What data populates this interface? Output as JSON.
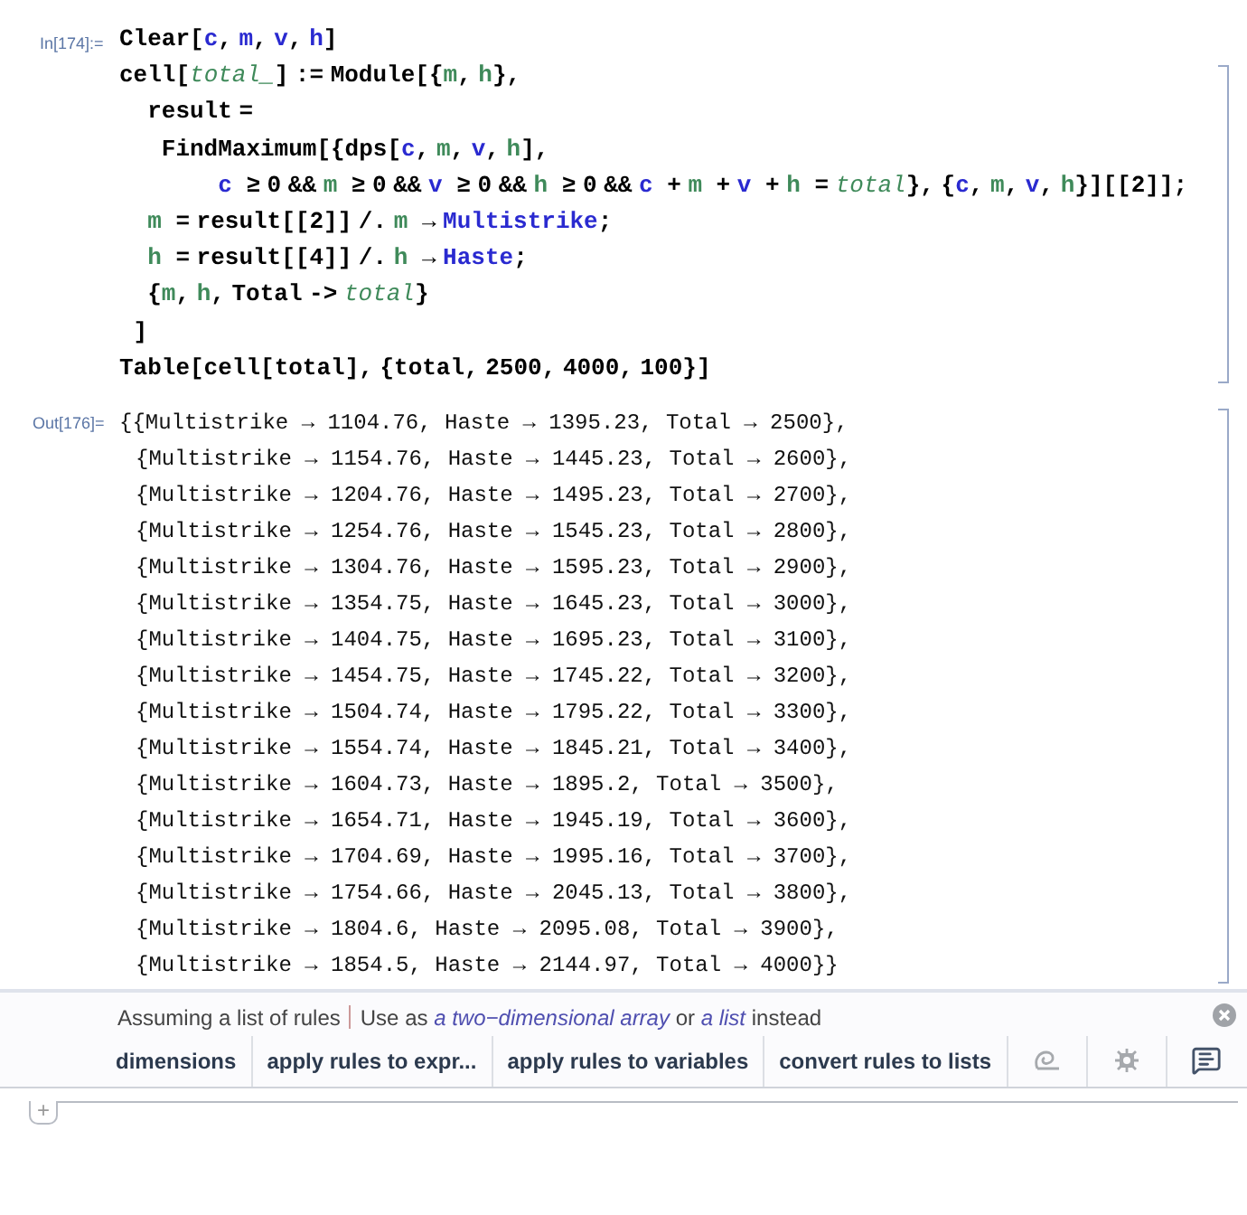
{
  "input_cell": {
    "label": "In[174]:=",
    "lines": [
      [
        {
          "text": "Clear[",
          "kind": "plain"
        },
        {
          "text": "c",
          "kind": "global"
        },
        {
          "text": ", ",
          "kind": "plain"
        },
        {
          "text": "m",
          "kind": "global"
        },
        {
          "text": ", ",
          "kind": "plain"
        },
        {
          "text": "v",
          "kind": "global"
        },
        {
          "text": ", ",
          "kind": "plain"
        },
        {
          "text": "h",
          "kind": "global"
        },
        {
          "text": "]",
          "kind": "plain"
        }
      ],
      [
        {
          "text": "cell[",
          "kind": "plain"
        },
        {
          "text": "total_",
          "kind": "pattern"
        },
        {
          "text": "] := Module[{",
          "kind": "plain"
        },
        {
          "text": "m",
          "kind": "local"
        },
        {
          "text": ", ",
          "kind": "plain"
        },
        {
          "text": "h",
          "kind": "local"
        },
        {
          "text": "},",
          "kind": "plain"
        }
      ],
      [
        {
          "text": "  result =",
          "kind": "plain"
        }
      ],
      [
        {
          "text": "   FindMaximum[{dps[",
          "kind": "plain"
        },
        {
          "text": "c",
          "kind": "global"
        },
        {
          "text": ", ",
          "kind": "plain"
        },
        {
          "text": "m",
          "kind": "local"
        },
        {
          "text": ", ",
          "kind": "plain"
        },
        {
          "text": "v",
          "kind": "global"
        },
        {
          "text": ", ",
          "kind": "plain"
        },
        {
          "text": "h",
          "kind": "local"
        },
        {
          "text": "],",
          "kind": "plain"
        }
      ],
      [
        {
          "text": "       c",
          "kind": "global"
        },
        {
          "text": " ≥ 0 && ",
          "kind": "plain"
        },
        {
          "text": "m",
          "kind": "local"
        },
        {
          "text": " ≥ 0 && ",
          "kind": "plain"
        },
        {
          "text": "v",
          "kind": "global"
        },
        {
          "text": " ≥ 0 && ",
          "kind": "plain"
        },
        {
          "text": "h",
          "kind": "local"
        },
        {
          "text": " ≥ 0 && ",
          "kind": "plain"
        },
        {
          "text": "c",
          "kind": "global"
        },
        {
          "text": " + ",
          "kind": "plain"
        },
        {
          "text": "m",
          "kind": "local"
        },
        {
          "text": " + ",
          "kind": "plain"
        },
        {
          "text": "v",
          "kind": "global"
        },
        {
          "text": " + ",
          "kind": "plain"
        },
        {
          "text": "h",
          "kind": "local"
        },
        {
          "text": " = ",
          "kind": "plain"
        },
        {
          "text": "total",
          "kind": "pattern"
        },
        {
          "text": "}, {",
          "kind": "plain"
        },
        {
          "text": "c",
          "kind": "global"
        },
        {
          "text": ", ",
          "kind": "plain"
        },
        {
          "text": "m",
          "kind": "local"
        },
        {
          "text": ", ",
          "kind": "plain"
        },
        {
          "text": "v",
          "kind": "global"
        },
        {
          "text": ", ",
          "kind": "plain"
        },
        {
          "text": "h",
          "kind": "local"
        },
        {
          "text": "}][[2]];",
          "kind": "plain"
        }
      ],
      [
        {
          "text": "  m",
          "kind": "local"
        },
        {
          "text": " = result[[2]] /. ",
          "kind": "plain"
        },
        {
          "text": "m",
          "kind": "local"
        },
        {
          "text": " → ",
          "kind": "plain"
        },
        {
          "text": "Multistrike",
          "kind": "global"
        },
        {
          "text": ";",
          "kind": "plain"
        }
      ],
      [
        {
          "text": "  h",
          "kind": "local"
        },
        {
          "text": " = result[[4]] /. ",
          "kind": "plain"
        },
        {
          "text": "h",
          "kind": "local"
        },
        {
          "text": " → ",
          "kind": "plain"
        },
        {
          "text": "Haste",
          "kind": "global"
        },
        {
          "text": ";",
          "kind": "plain"
        }
      ],
      [
        {
          "text": "  {",
          "kind": "plain"
        },
        {
          "text": "m",
          "kind": "local"
        },
        {
          "text": ", ",
          "kind": "plain"
        },
        {
          "text": "h",
          "kind": "local"
        },
        {
          "text": ", Total -> ",
          "kind": "plain"
        },
        {
          "text": "total",
          "kind": "pattern"
        },
        {
          "text": "}",
          "kind": "plain"
        }
      ],
      [
        {
          "text": " ]",
          "kind": "plain"
        }
      ],
      [
        {
          "text": "Table[cell[total], {total, 2500, 4000, 100}]",
          "kind": "plain"
        }
      ]
    ]
  },
  "output_cell": {
    "label": "Out[176]=",
    "rows": [
      "{{Multistrike → 1104.76, Haste → 1395.23, Total → 2500},",
      "{Multistrike → 1154.76, Haste → 1445.23, Total → 2600},",
      "{Multistrike → 1204.76, Haste → 1495.23, Total → 2700},",
      "{Multistrike → 1254.76, Haste → 1545.23, Total → 2800},",
      "{Multistrike → 1304.76, Haste → 1595.23, Total → 2900},",
      "{Multistrike → 1354.75, Haste → 1645.23, Total → 3000},",
      "{Multistrike → 1404.75, Haste → 1695.23, Total → 3100},",
      "{Multistrike → 1454.75, Haste → 1745.22, Total → 3200},",
      "{Multistrike → 1504.74, Haste → 1795.22, Total → 3300},",
      "{Multistrike → 1554.74, Haste → 1845.21, Total → 3400},",
      "{Multistrike → 1604.73, Haste → 1895.2, Total → 3500},",
      "{Multistrike → 1654.71, Haste → 1945.19, Total → 3600},",
      "{Multistrike → 1704.69, Haste → 1995.16, Total → 3700},",
      "{Multistrike → 1754.66, Haste → 2045.13, Total → 3800},",
      "{Multistrike → 1804.6, Haste → 2095.08, Total → 3900},",
      "{Multistrike → 1854.5, Haste → 2144.97, Total → 4000}}"
    ]
  },
  "suggestions_bar": {
    "assumption": "Assuming a list of rules",
    "alternative": [
      {
        "kind": "text",
        "text": "Use as "
      },
      {
        "kind": "link",
        "text": "a two−dimensional array"
      },
      {
        "kind": "text",
        "text": " or "
      },
      {
        "kind": "link",
        "text": "a list"
      },
      {
        "kind": "text",
        "text": " instead"
      }
    ],
    "buttons": [
      "dimensions",
      "apply rules to expr...",
      "apply rules to variables",
      "convert rules to lists"
    ]
  },
  "new_cell_button": "+"
}
